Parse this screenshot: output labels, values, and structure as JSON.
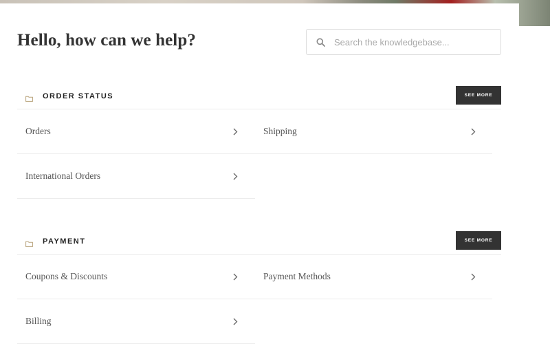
{
  "header": {
    "title": "Hello, how can we help?"
  },
  "search": {
    "placeholder": "Search the knowledgebase...",
    "value": ""
  },
  "sections": [
    {
      "title": "ORDER STATUS",
      "see_more_label": "SEE MORE",
      "items": [
        {
          "label": "Orders"
        },
        {
          "label": "Shipping"
        },
        {
          "label": "International Orders"
        }
      ]
    },
    {
      "title": "PAYMENT",
      "see_more_label": "SEE MORE",
      "items": [
        {
          "label": "Coupons & Discounts"
        },
        {
          "label": "Payment Methods"
        },
        {
          "label": "Billing"
        }
      ]
    }
  ],
  "icons": {
    "search": "search-icon",
    "folder": "folder-icon",
    "chevron": "chevron-right-icon"
  },
  "colors": {
    "button_bg": "#333333",
    "button_text": "#ffffff",
    "folder_icon": "#b8a27a",
    "divider": "#ececec"
  }
}
